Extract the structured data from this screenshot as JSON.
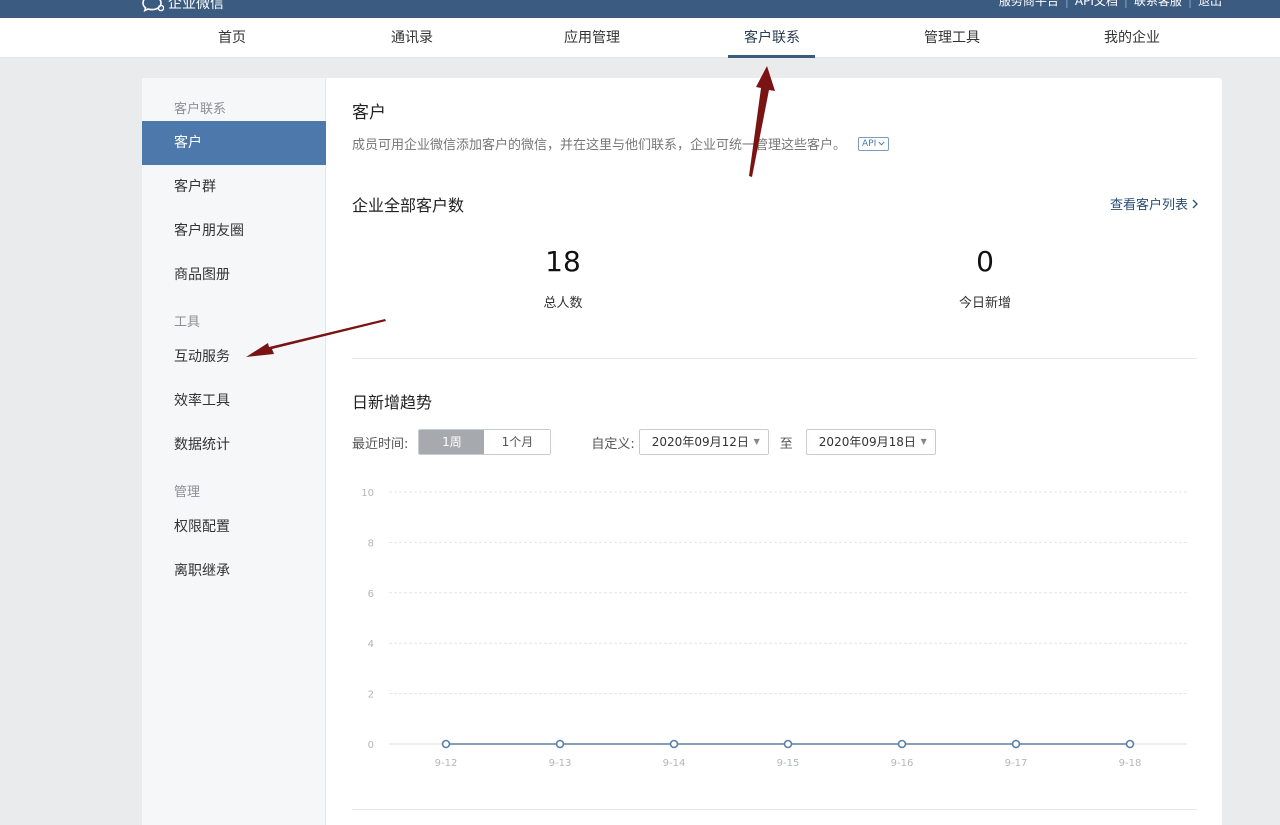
{
  "header": {
    "logo_text": "企业微信",
    "links": [
      "服务商平台",
      "API文档",
      "联系客服",
      "退出"
    ]
  },
  "nav": {
    "items": [
      "首页",
      "通讯录",
      "应用管理",
      "客户联系",
      "管理工具",
      "我的企业"
    ],
    "active_index": 3
  },
  "sidebar": {
    "groups": [
      {
        "label": "客户联系",
        "items": [
          "客户",
          "客户群",
          "客户朋友圈",
          "商品图册"
        ]
      },
      {
        "label": "工具",
        "items": [
          "互动服务",
          "效率工具",
          "数据统计"
        ]
      },
      {
        "label": "管理",
        "items": [
          "权限配置",
          "离职继承"
        ]
      }
    ],
    "active_item": "客户"
  },
  "main": {
    "title": "客户",
    "description": "成员可用企业微信添加客户的微信，并在这里与他们联系，企业可统一管理这些客户。",
    "api_badge": "API",
    "summary_title": "企业全部客户数",
    "view_list_link": "查看客户列表",
    "stats": [
      {
        "value": "18",
        "label": "总人数"
      },
      {
        "value": "0",
        "label": "今日新增"
      }
    ],
    "trend_title": "日新增趋势",
    "filter": {
      "recent_label": "最近时间:",
      "ranges": [
        "1周",
        "1个月"
      ],
      "active_range": "1周",
      "custom_label": "自定义:",
      "start_date": "2020年09月12日",
      "to_label": "至",
      "end_date": "2020年09月18日"
    }
  },
  "chart_data": {
    "type": "line",
    "categories": [
      "9-12",
      "9-13",
      "9-14",
      "9-15",
      "9-16",
      "9-17",
      "9-18"
    ],
    "values": [
      0,
      0,
      0,
      0,
      0,
      0,
      0
    ],
    "y_ticks": [
      0,
      2,
      4,
      6,
      8,
      10
    ],
    "ylim": [
      0,
      10
    ],
    "grid": true,
    "line_color": "#5b7fa6"
  },
  "colors": {
    "header_bg": "#3b5b80",
    "sidebar_active": "#4d78ab",
    "annotation_arrow": "#7a1414"
  }
}
